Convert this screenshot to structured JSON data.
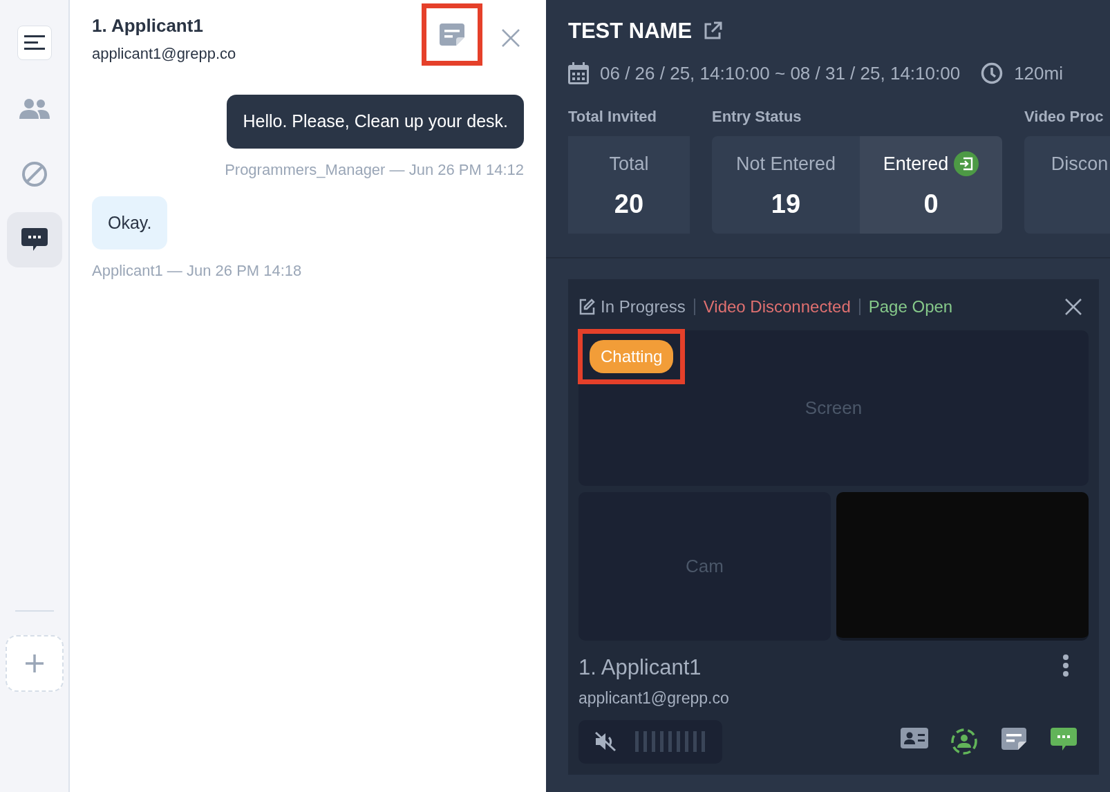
{
  "rail": {
    "items": [
      {
        "kind": "menu",
        "selected": false
      },
      {
        "kind": "people",
        "selected": false
      },
      {
        "kind": "ban",
        "selected": false
      },
      {
        "kind": "chat",
        "selected": true
      }
    ]
  },
  "chat": {
    "title": "1. Applicant1",
    "email": "applicant1@grepp.co",
    "memo_highlighted": true,
    "messages": [
      {
        "text": "Hello. Please, Clean up your desk.",
        "meta": "Programmers_Manager — Jun 26 PM 14:12",
        "mine": true
      },
      {
        "text": "Okay.",
        "meta": "Applicant1 — Jun 26 PM 14:18",
        "mine": false
      }
    ]
  },
  "test": {
    "title": "TEST NAME",
    "date_range": "06 / 26 / 25, 14:10:00 ~ 08 / 31 / 25, 14:10:00",
    "duration": "120mi",
    "groups": [
      {
        "label": "Total Invited",
        "cards": [
          {
            "label": "Total",
            "value": "20",
            "selected": false
          }
        ]
      },
      {
        "label": "Entry Status",
        "cards": [
          {
            "label": "Not Entered",
            "value": "19",
            "selected": false
          },
          {
            "label": "Entered",
            "value": "0",
            "selected": true
          }
        ]
      },
      {
        "label": "Video Proc",
        "cards": [
          {
            "label": "Discon",
            "selected": false
          }
        ]
      }
    ]
  },
  "applicant": {
    "statuses": [
      {
        "text": "In Progress",
        "color": "#a3adbd"
      },
      {
        "text": "Video Disconnected",
        "color": "#e07070"
      },
      {
        "text": "Page Open",
        "color": "#86c98a"
      }
    ],
    "badge": "Chatting",
    "badge_highlighted": true,
    "screen_label": "Screen",
    "cam_label": "Cam",
    "name": "1. Applicant1",
    "email": "applicant1@grepp.co",
    "muted": true,
    "level": 0,
    "actions": [
      {
        "kind": "id-card",
        "active": false
      },
      {
        "kind": "face",
        "active": true
      },
      {
        "kind": "memo",
        "active": false
      },
      {
        "kind": "chat",
        "active": true
      }
    ]
  }
}
